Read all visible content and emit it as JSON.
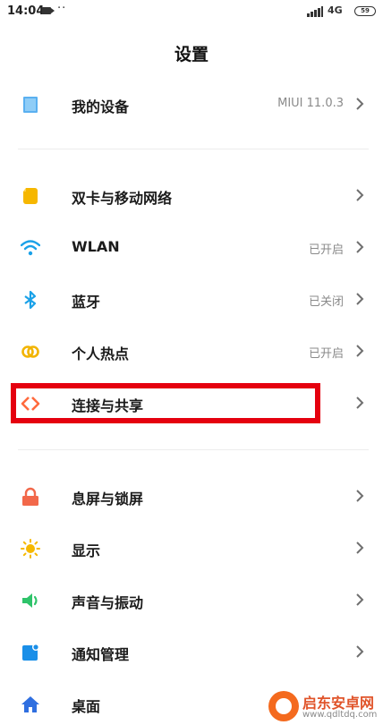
{
  "status_bar": {
    "time": "14:04",
    "dots": "··",
    "network": "4G",
    "battery": "59"
  },
  "header": {
    "title": "设置"
  },
  "items": [
    {
      "label": "我的设备",
      "value": "MIUI 11.0.3"
    },
    {
      "label": "双卡与移动网络",
      "value": ""
    },
    {
      "label": "WLAN",
      "value": "已开启"
    },
    {
      "label": "蓝牙",
      "value": "已关闭"
    },
    {
      "label": "个人热点",
      "value": "已开启"
    },
    {
      "label": "连接与共享",
      "value": ""
    },
    {
      "label": "息屏与锁屏",
      "value": ""
    },
    {
      "label": "显示",
      "value": ""
    },
    {
      "label": "声音与振动",
      "value": ""
    },
    {
      "label": "通知管理",
      "value": ""
    },
    {
      "label": "桌面",
      "value": ""
    }
  ],
  "icons": [
    "device-icon",
    "sim-card-icon",
    "wifi-icon",
    "bluetooth-icon",
    "hotspot-icon",
    "connection-share-icon",
    "lock-icon",
    "brightness-icon",
    "sound-icon",
    "notification-icon",
    "home-icon"
  ],
  "colors": {
    "highlight": "#e5000f",
    "chevron": "#6f6f6f",
    "value_text": "#8a8a8a"
  },
  "watermark": {
    "brand": "启东安卓网",
    "url": "www.qdltdq.com"
  }
}
